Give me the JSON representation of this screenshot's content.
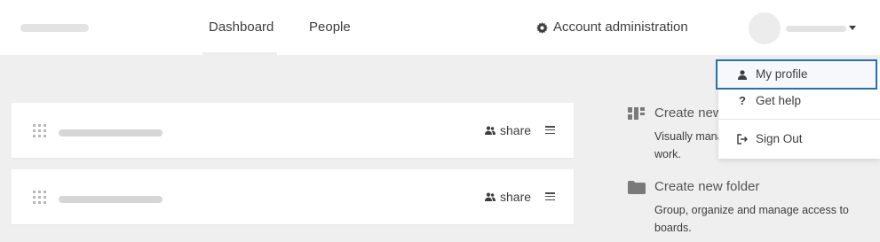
{
  "nav": {
    "dashboard_label": "Dashboard",
    "people_label": "People",
    "account_admin_label": "Account administration"
  },
  "boards": [
    {
      "share_label": "share"
    },
    {
      "share_label": "share"
    }
  ],
  "create": {
    "dashboard_title": "Create new",
    "dashboard_desc": "Visually mana... work.",
    "dashboard_desc_line1": "Visually mana",
    "dashboard_desc_line2": "work.",
    "folder_title": "Create new folder",
    "folder_desc_line1": "Group, organize and manage access to",
    "folder_desc_line2": "boards."
  },
  "user_dropdown": {
    "items": [
      {
        "label": "My profile",
        "icon": "user-icon"
      },
      {
        "label": "Get help",
        "icon": "question-icon"
      },
      {
        "label": "Sign Out",
        "icon": "sign-out-icon"
      }
    ]
  },
  "colors": {
    "background": "#efefef",
    "card": "#ffffff",
    "focus_outline": "#2a6fa8"
  }
}
